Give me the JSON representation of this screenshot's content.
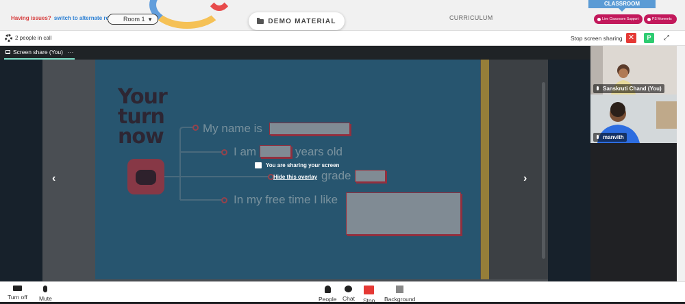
{
  "header": {
    "issues_text": "Having issues?",
    "switch_link": "switch to alternate room",
    "room_label": "Room 1",
    "room_caret": "▼",
    "demo_label": "DEMO MATERIAL",
    "curriculum_label": "CURRICULUM",
    "classroom_label": "CLASSROOM",
    "support_label": "Live Classroom Support",
    "moments_label": "PS Moments"
  },
  "callbar": {
    "people_count": "2 people in call",
    "stop_sharing": "Stop screen sharing",
    "close_glyph": "✕",
    "p_label": "P",
    "expand_glyph": "⤢"
  },
  "tab": {
    "label": "Screen share (You)",
    "more": "···"
  },
  "slide": {
    "heading": "Your turn now",
    "line1": "My name is",
    "line2_a": "I am",
    "line2_b": "years old",
    "line3": "grade",
    "line4": "In my free time I like"
  },
  "overlay": {
    "message": "You are sharing your screen",
    "hide": "Hide this overlay"
  },
  "nav": {
    "prev": "‹",
    "next": "›"
  },
  "participants": [
    {
      "name": "Sanskruti Chand (You)"
    },
    {
      "name": "manvith"
    }
  ],
  "bottom": {
    "turn_off": "Turn off",
    "mute": "Mute",
    "people": "People",
    "chat": "Chat",
    "stop": "Stop",
    "background": "Background"
  },
  "colors": {
    "accent_green": "#2ecc71",
    "alert_red": "#e53935",
    "pill_pink": "#c2185b",
    "classroom_blue": "#5b9bd5"
  }
}
